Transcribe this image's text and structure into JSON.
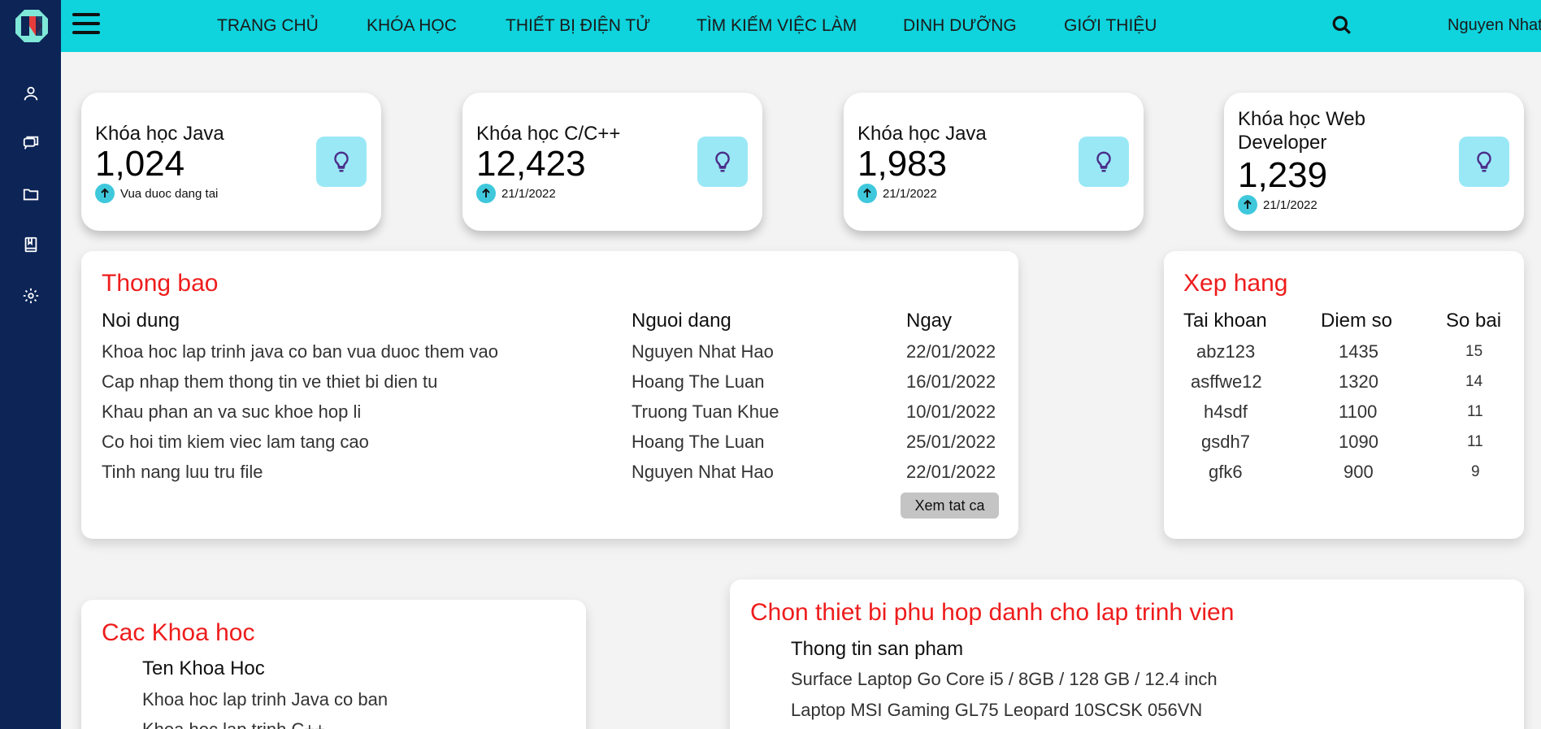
{
  "nav": {
    "items": [
      "TRANG CHỦ",
      "KHÓA HỌC",
      "THIẾT BỊ ĐIỆN TỬ",
      "TÌM KIẾM VIỆC LÀM",
      "DINH DƯỠNG",
      "GIỚI THIỆU"
    ],
    "user_name": "Nguyen Nhat Hao"
  },
  "sidebar": {
    "icons": [
      "user-icon",
      "chat-icon",
      "folder-icon",
      "book-icon",
      "gear-icon"
    ]
  },
  "cards": [
    {
      "title": "Khóa học Java",
      "value": "1,024",
      "note": "Vua duoc dang tai"
    },
    {
      "title": "Khóa học C/C++",
      "value": "12,423",
      "note": "21/1/2022"
    },
    {
      "title": "Khóa học Java",
      "value": "1,983",
      "note": "21/1/2022"
    },
    {
      "title": "Khóa học Web Developer",
      "value": "1,239",
      "note": "21/1/2022"
    }
  ],
  "announcements": {
    "title": "Thong bao",
    "headers": [
      "Noi dung",
      "Nguoi dang",
      "Ngay"
    ],
    "rows": [
      [
        "Khoa hoc lap trinh java co ban vua duoc them vao",
        "Nguyen Nhat Hao",
        "22/01/2022"
      ],
      [
        "Cap nhap them thong tin ve thiet bi dien tu",
        "Hoang The Luan",
        "16/01/2022"
      ],
      [
        "Khau phan an va suc khoe hop li",
        "Truong Tuan Khue",
        "10/01/2022"
      ],
      [
        "Co hoi tim kiem viec lam tang cao",
        "Hoang The Luan",
        "25/01/2022"
      ],
      [
        "Tinh nang luu tru file",
        "Nguyen Nhat Hao",
        "22/01/2022"
      ]
    ],
    "view_all": "Xem tat ca"
  },
  "ranking": {
    "title": "Xep hang",
    "headers": [
      "Tai khoan",
      "Diem so",
      "So bai"
    ],
    "rows": [
      [
        "abz123",
        "1435",
        "15"
      ],
      [
        "asffwe12",
        "1320",
        "14"
      ],
      [
        "h4sdf",
        "1100",
        "11"
      ],
      [
        "gsdh7",
        "1090",
        "11"
      ],
      [
        "gfk6",
        "900",
        "9"
      ]
    ]
  },
  "courses": {
    "title": "Cac Khoa hoc",
    "header": "Ten Khoa Hoc",
    "items": [
      "Khoa hoc lap trinh Java co ban",
      "Khoa hoc lap trinh C++"
    ]
  },
  "devices": {
    "title": "Chon thiet bi phu hop danh cho lap trinh vien",
    "header": "Thong tin san pham",
    "items": [
      "Surface Laptop Go Core i5 / 8GB / 128 GB / 12.4 inch",
      "Laptop MSI Gaming GL75 Leopard 10SCSK 056VN"
    ]
  },
  "colors": {
    "sidebar": "#0c2456",
    "topbar": "#0fd3dd",
    "accent_red": "#ee1c1c",
    "icon_bg": "#9ae8f6"
  }
}
